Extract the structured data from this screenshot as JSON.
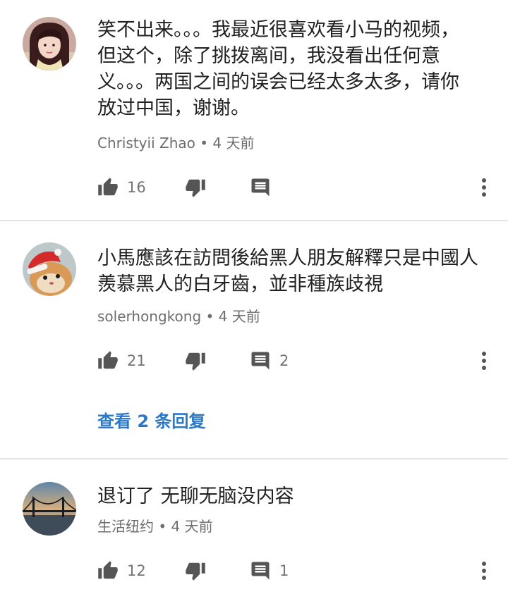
{
  "comments": [
    {
      "text": "笑不出来。。。我最近很喜欢看小马的视频，\n但这个，除了挑拨离间，我没看出任何意\n义。。。两国之间的误会已经太多太多，请你\n放过中国，谢谢。",
      "author": "Christyii Zhao",
      "time": "4 天前",
      "likes": "16",
      "replies": ""
    },
    {
      "text": "小馬應該在訪問後給黑人朋友解釋只是中國人\n羨慕黑人的白牙齒，並非種族歧視",
      "author": "solerhongkong",
      "time": "4 天前",
      "likes": "21",
      "replies": "2",
      "view_replies": "查看 2 条回复"
    },
    {
      "text": "退订了 无聊无脑没内容",
      "author": "生活纽约",
      "time": "4 天前",
      "likes": "12",
      "replies": "1"
    }
  ],
  "separator": " • ",
  "icons": {
    "like": "thumb-up-icon",
    "dislike": "thumb-down-icon",
    "reply": "comment-icon",
    "more": "more-vert-icon"
  },
  "colors": {
    "text": "#212121",
    "meta": "#6e6e6e",
    "icon": "#555555",
    "link": "#2a78c7",
    "divider": "#e3e3e3"
  }
}
